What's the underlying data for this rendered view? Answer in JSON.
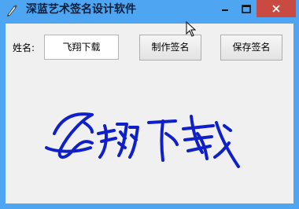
{
  "window": {
    "title": "深蓝艺术签名设计软件",
    "icon": "pen-icon",
    "controls": {
      "minimize_icon": "minimize-icon",
      "maximize_icon": "maximize-icon",
      "close_icon": "close-icon"
    }
  },
  "form": {
    "name_label": "姓名:",
    "name_value": "飞翔下载",
    "make_button": "制作签名",
    "save_button": "保存签名"
  },
  "signature": {
    "text": "飞翔下载",
    "color": "#1020c8"
  },
  "colors": {
    "titlebar": "#4ea6f2",
    "close_button": "#c94a41",
    "client_bg": "#f0f0f0"
  }
}
